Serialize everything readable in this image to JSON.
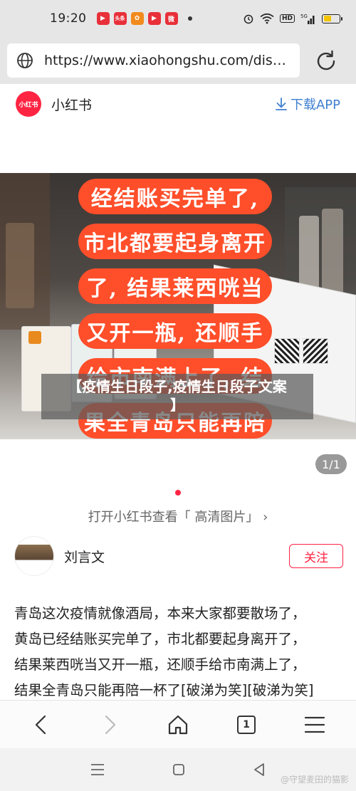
{
  "status": {
    "time": "19:20",
    "app_icons": [
      {
        "name": "app-icon-red",
        "color": "#e8303a",
        "glyph": "▶"
      },
      {
        "name": "toutiao-icon",
        "color": "#e8303a",
        "glyph": "头条"
      },
      {
        "name": "app-icon-orange",
        "color": "#f28a1c",
        "glyph": "✿"
      },
      {
        "name": "video-icon",
        "color": "#e8303a",
        "glyph": "▶"
      },
      {
        "name": "weibo-icon",
        "color": "#e8303a",
        "glyph": "微"
      }
    ],
    "battery_level": 0.5
  },
  "browser": {
    "url": "https://www.xiaohongshu.com/disc..."
  },
  "site": {
    "logo_text": "小红书",
    "name": "小红书",
    "download_label": "下载APP"
  },
  "post": {
    "image_caption_lines": [
      "经结账买完单了,",
      "市北都要起身离开",
      "了, 结果莱西咣当",
      "又开一瓶, 还顺手",
      "给市南满上了, 结",
      "果全青岛只能再陪"
    ],
    "title_line1": "【疫情生日段子,疫情生日段子文案",
    "title_line2": "】",
    "page_counter": "1/1",
    "open_hint": "打开小红书查看「 高清图片」 ›"
  },
  "author": {
    "name": "刘言文",
    "follow_label": "关注"
  },
  "content": {
    "lines": [
      "青岛这次疫情就像酒局，本来大家都要散场了，",
      "黄岛已经结账买完单了，市北都要起身离开了，",
      "结果莱西咣当又开一瓶，还顺手给市南满上了，",
      "结果全青岛只能再陪一杯了[破涕为笑][破涕为笑]"
    ]
  },
  "browser_nav": {
    "tab_count": "1"
  },
  "watermark": "@守望麦田的猫影",
  "colors": {
    "brand": "#ff2442",
    "link": "#3f7fd1",
    "caption_bg": "#ff4e2a"
  }
}
